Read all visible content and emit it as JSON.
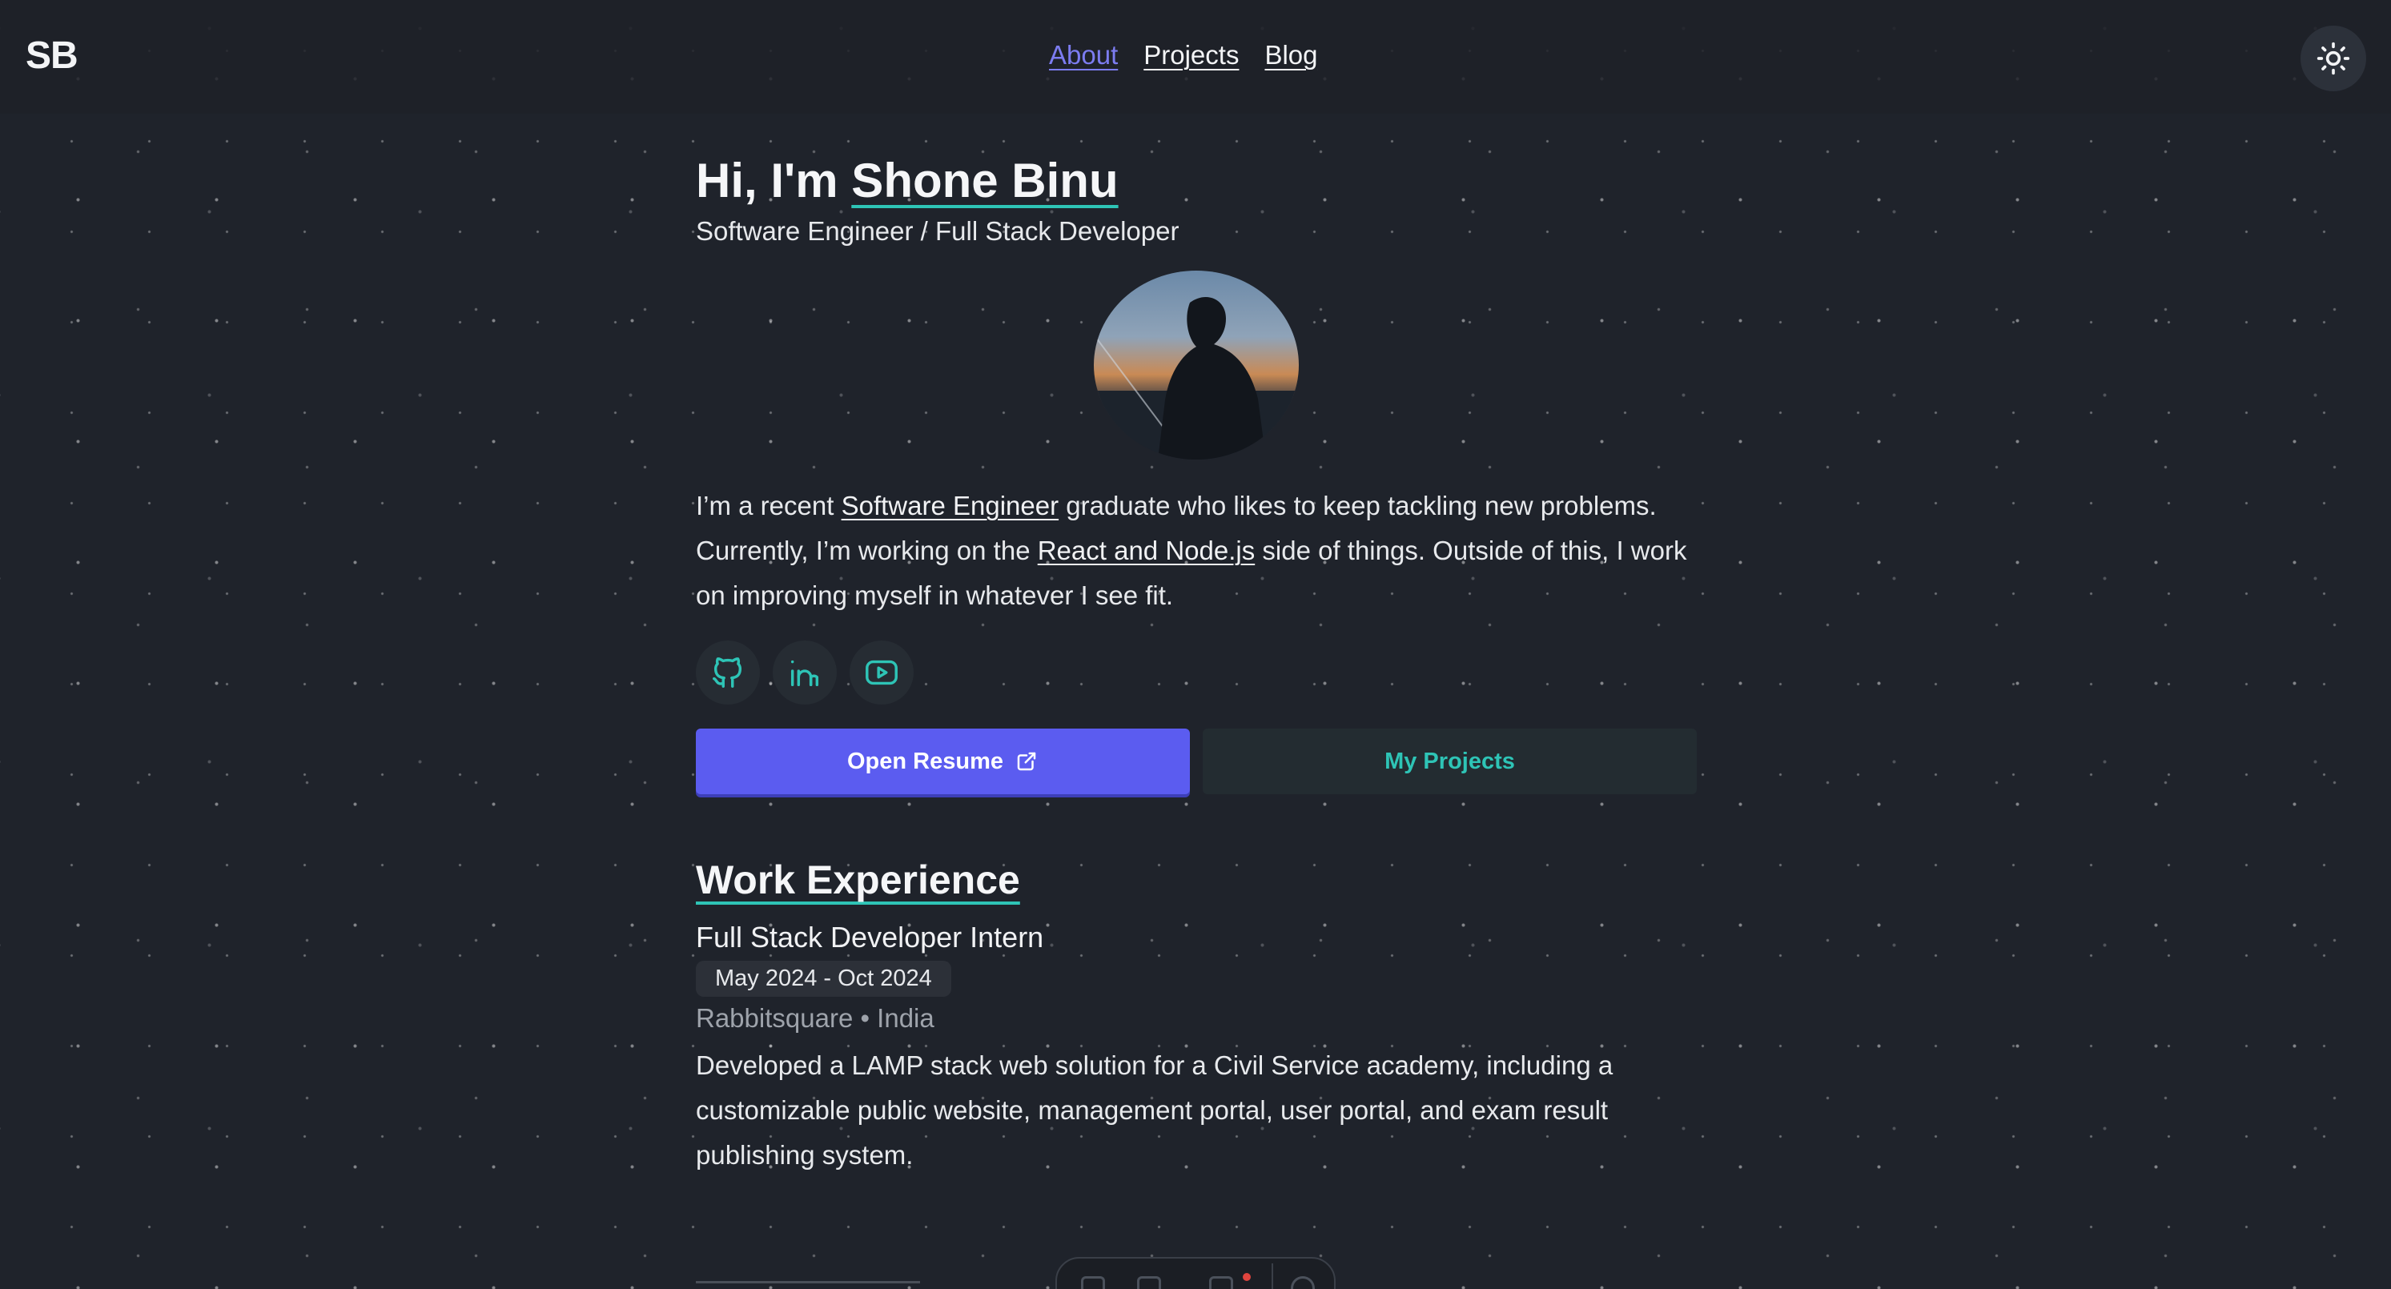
{
  "header": {
    "logo": "SB",
    "nav": [
      {
        "label": "About",
        "active": true
      },
      {
        "label": "Projects",
        "active": false
      },
      {
        "label": "Blog",
        "active": false
      }
    ],
    "theme_toggle_icon": "sun-icon"
  },
  "hero": {
    "greeting": "Hi, I'm ",
    "name": "Shone Binu",
    "subtitle": "Software Engineer / Full Stack Developer",
    "avatar_icon": "profile-photo"
  },
  "bio": {
    "part1": "I’m a recent ",
    "link1": "Software Engineer",
    "part2": " graduate who likes to keep tackling new problems. Currently, I’m working on the ",
    "link2": "React and Node.js",
    "part3": " side of things. Outside of this, I work on improving myself in whatever I see fit."
  },
  "socials": [
    {
      "icon": "github-icon"
    },
    {
      "icon": "linkedin-icon"
    },
    {
      "icon": "youtube-icon"
    }
  ],
  "buttons": {
    "resume": "Open Resume",
    "projects": "My Projects"
  },
  "work": {
    "section_title": "Work Experience",
    "jobs": [
      {
        "title": "Full Stack Developer Intern",
        "date": "May 2024 - Oct 2024",
        "company": "Rabbitsquare • India",
        "description": "Developed a LAMP stack web solution for a Civil Service academy, including a customizable public website, management portal, user portal, and exam result publishing system."
      }
    ]
  },
  "colors": {
    "background": "#1f232b",
    "accent": "#2ec4b6",
    "primary": "#5b5cf0",
    "nav_active": "#7c7cf0"
  }
}
